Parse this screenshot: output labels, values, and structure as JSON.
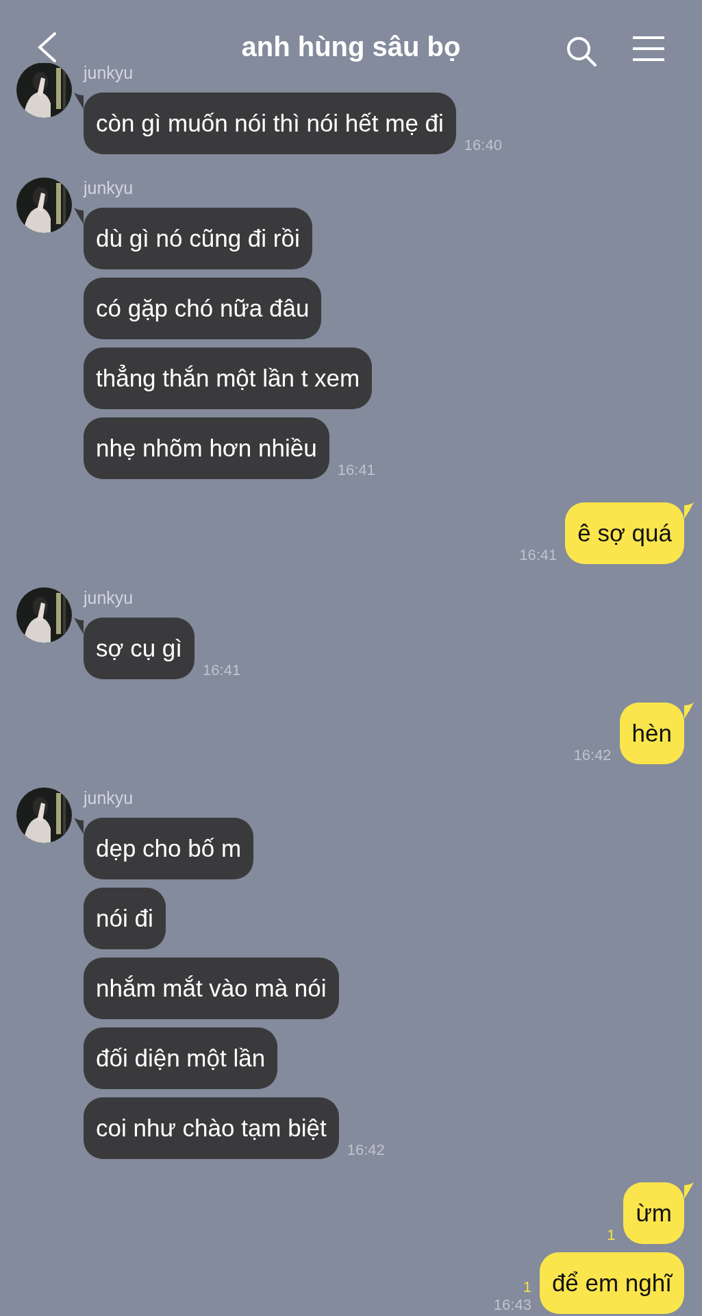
{
  "header": {
    "title": "anh hùng sâu bọ"
  },
  "messages": [
    {
      "kind": "received",
      "sender": "junkyu",
      "bubbles": [
        {
          "text": "còn gì muốn nói thì nói hết mẹ đi",
          "time": "16:40"
        }
      ]
    },
    {
      "kind": "received",
      "sender": "junkyu",
      "bubbles": [
        {
          "text": "dù gì nó cũng đi rồi"
        },
        {
          "text": "có gặp chó nữa đâu"
        },
        {
          "text": "thẳng thắn một lần t xem"
        },
        {
          "text": "nhẹ nhõm hơn nhiều",
          "time": "16:41"
        }
      ]
    },
    {
      "kind": "sent",
      "bubbles": [
        {
          "text": "ê sợ quá",
          "time": "16:41"
        }
      ]
    },
    {
      "kind": "received",
      "sender": "junkyu",
      "bubbles": [
        {
          "text": "sợ cụ gì",
          "time": "16:41"
        }
      ]
    },
    {
      "kind": "sent",
      "bubbles": [
        {
          "text": "hèn",
          "time": "16:42"
        }
      ]
    },
    {
      "kind": "received",
      "sender": "junkyu",
      "bubbles": [
        {
          "text": "dẹp cho bố m"
        },
        {
          "text": "nói đi"
        },
        {
          "text": "nhắm mắt vào mà nói"
        },
        {
          "text": "đối diện một lần"
        },
        {
          "text": "coi như chào tạm biệt",
          "time": "16:42"
        }
      ]
    },
    {
      "kind": "sent",
      "bubbles": [
        {
          "text": "ừm",
          "unread": "1"
        },
        {
          "text": "để em nghĩ",
          "unread": "1",
          "time": "16:43"
        }
      ]
    }
  ]
}
